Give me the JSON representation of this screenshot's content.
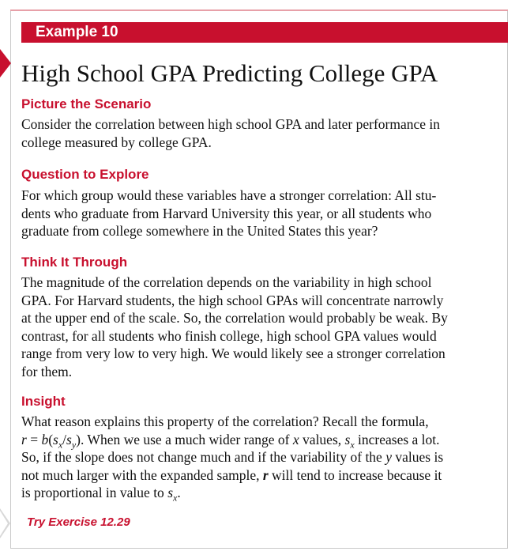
{
  "banner": {
    "label": "Example 10"
  },
  "title": "High School GPA Predicting College GPA",
  "sections": [
    {
      "heading": "Picture the Scenario",
      "lines": [
        "Consider the correlation between high school GPA and later performance in",
        "college measured by college GPA."
      ]
    },
    {
      "heading": "Question to Explore",
      "lines": [
        "For which group would these variables have a stronger correlation: All stu-",
        "dents who graduate from Harvard University this year, or all students who",
        "graduate from college somewhere in the United States this year?"
      ]
    },
    {
      "heading": "Think It Through",
      "lines": [
        "The magnitude of the correlation depends on the variability in high school",
        "GPA. For Harvard students, the high school GPAs will concentrate narrowly",
        "at the upper end of the scale. So, the correlation would probably be weak. By",
        "contrast, for all students who finish college, high school GPA values would",
        "range from very low to very high. We would likely see a stronger correlation",
        "for them."
      ]
    },
    {
      "heading": "Insight",
      "line1": "What reason explains this property of the correlation? Recall the formula,",
      "line2_pre": " = ",
      "line2_mid": "). When we use a much wider range of ",
      "line2_post1": " values, ",
      "line2_post2": " increases a lot.",
      "line3": "So, if the slope does not change much and if the variability of the ",
      "line3_post": " values is",
      "line4": "not much larger with the expanded sample, ",
      "line4_post": " will tend to increase because it",
      "line5": "is proportional in value to ",
      "var_r": "r",
      "var_b": "b",
      "var_s": "s",
      "var_x": "x",
      "var_y": "y"
    }
  ],
  "footer": {
    "try_exercise": "Try Exercise 12.29"
  },
  "colors": {
    "accent": "#c8102e",
    "border": "#c9c9c9"
  }
}
